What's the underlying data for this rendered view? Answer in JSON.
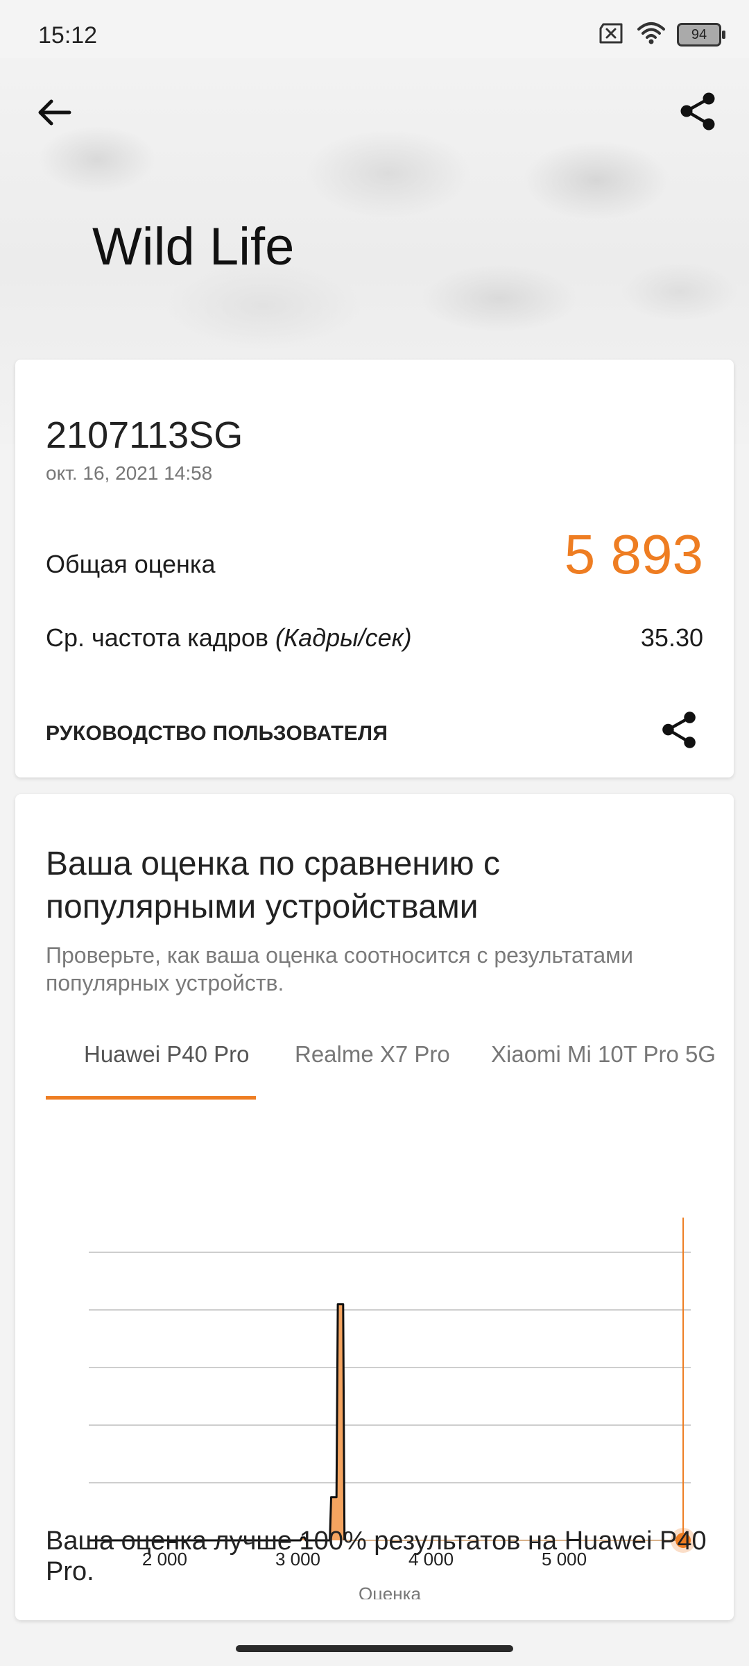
{
  "status_bar": {
    "time": "15:12",
    "battery": "94",
    "icons": [
      "sim-off-icon",
      "wifi-icon",
      "battery-icon"
    ]
  },
  "header": {
    "title": "Wild Life",
    "back_icon": "arrow-left-icon",
    "share_icon": "share-icon"
  },
  "result": {
    "device": "2107113SG",
    "date": "окт. 16, 2021 14:58",
    "overall_label": "Общая оценка",
    "overall_score": "5 893",
    "fps_label_prefix": "Ср. частота кадров ",
    "fps_label_unit": "(Кадры/сек)",
    "fps_value": "35.30",
    "guide_label": "РУКОВОДСТВО ПОЛЬЗОВАТЕЛЯ"
  },
  "comparison": {
    "title": "Ваша оценка по сравнению с популярными устройствами",
    "subtitle": "Проверьте, как ваша оценка соотносится с результатами популярных устройств.",
    "tabs": [
      {
        "label": "Huawei P40 Pro",
        "active": true
      },
      {
        "label": "Realme X7 Pro",
        "active": false
      },
      {
        "label": "Xiaomi Mi 10T Pro 5G",
        "active": false
      }
    ],
    "verdict": "Ваша оценка лучше 100% результатов на Huawei P40 Pro."
  },
  "colors": {
    "accent": "#ee7d22",
    "bar_fill": "#f4a460"
  },
  "chart_data": {
    "type": "area",
    "xlabel": "Оценка",
    "x_ticks": [
      "2 000",
      "3 000",
      "4 000",
      "5 000"
    ],
    "x_tick_values": [
      2000,
      3000,
      4000,
      5000
    ],
    "xlim": [
      1430,
      5950
    ],
    "ylim": [
      0,
      100
    ],
    "y_grid": [
      20,
      40,
      60,
      80,
      100
    ],
    "distribution": {
      "x": [
        1430,
        3020,
        3030,
        3050,
        3060,
        3240,
        3250,
        3290,
        3300,
        3340,
        3350
      ],
      "y": [
        0,
        0,
        1,
        1,
        0,
        0,
        15,
        15,
        82,
        82,
        0
      ]
    },
    "your_score": 5893
  }
}
